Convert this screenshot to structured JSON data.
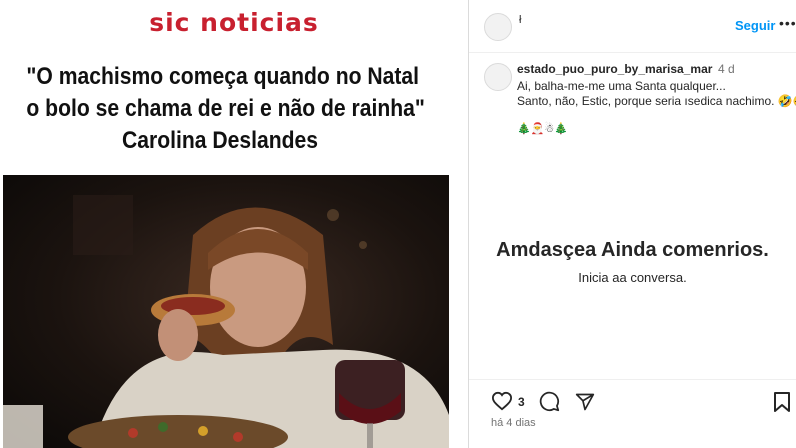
{
  "media": {
    "logo": "sic noticias",
    "quote_line1": "\"O machismo começa quando no Natal",
    "quote_line2": "o bolo se chama de rei e não de rainha\"",
    "quote_line3": "Carolina Deslandes"
  },
  "header": {
    "username": "ł",
    "follow_label": "Seguir",
    "more": "•••"
  },
  "comment": {
    "username": "estado_puo_puro_by_marisa_mar",
    "time": "4 d",
    "line1": "Ai, balha-me-me uma  Santa qualquer...",
    "line2": "Santo, não, Estic, porque seria ısedica nachimo. 🤣🤣",
    "emojis": "🎄🎅☃🎄"
  },
  "empty_state": {
    "title": "Amdasçea Ainda comenrios.",
    "subtitle": "Inicia aa conversa."
  },
  "footer": {
    "like_count": "3",
    "date": "há 4 dias"
  },
  "colors": {
    "brand_red": "#c8202f",
    "link_blue": "#0095f6"
  }
}
